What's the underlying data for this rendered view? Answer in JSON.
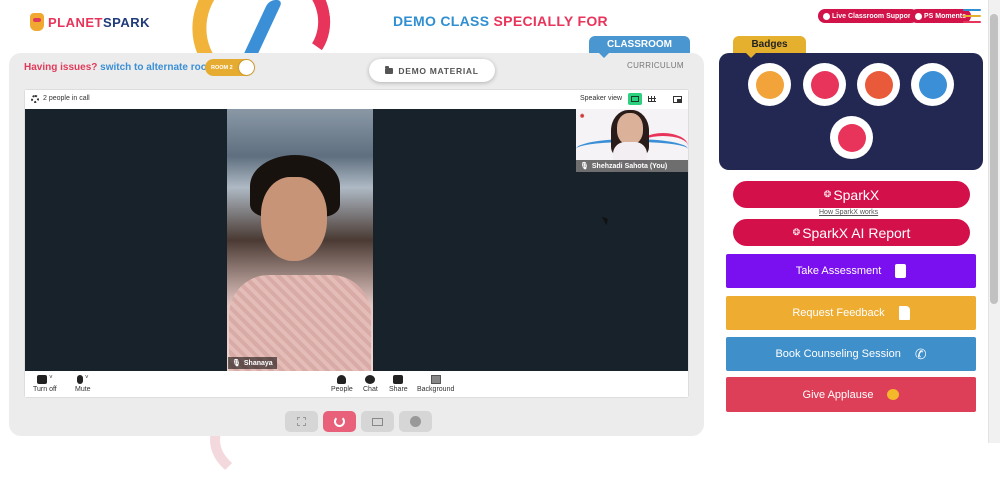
{
  "header": {
    "logo_part1": "PLANET",
    "logo_part2": "SPARK",
    "title_part1": "DEMO CLASS",
    "title_part2": "SPECIALLY FOR",
    "live_support_label": "Live Classroom Support",
    "ps_moments_label": "PS Moments",
    "menu_colors": [
      "#2f8fd1",
      "#e5b02d",
      "#e8345a"
    ]
  },
  "classroom": {
    "tab_label": "CLASSROOM",
    "curriculum_label": "CURRICULUM",
    "issues_question": "Having issues?",
    "issues_link": "switch to alternate room",
    "room_toggle_label": "ROOM 2",
    "demo_material_label": "DEMO MATERIAL",
    "call": {
      "people_in_call": "2 people in call",
      "speaker_view_label": "Speaker view",
      "main_participant": "Shanaya",
      "self_participant": "Shehzadi Sahota (You)",
      "controls": [
        {
          "label": "Turn off",
          "icon": "camera-icon"
        },
        {
          "label": "Mute",
          "icon": "microphone-icon"
        },
        {
          "label": "People",
          "icon": "people-icon"
        },
        {
          "label": "Chat",
          "icon": "chat-icon"
        },
        {
          "label": "Share",
          "icon": "share-screen-icon"
        },
        {
          "label": "Background",
          "icon": "background-icon"
        }
      ]
    },
    "bottom_controls": [
      "fullscreen-icon",
      "power-icon",
      "screen-icon",
      "palette-icon"
    ]
  },
  "badges": {
    "tab_label": "Badges",
    "items": [
      {
        "icon": "trophy-badge-icon",
        "color": "#f2a33a"
      },
      {
        "icon": "hands-badge-icon",
        "color": "#e8345a"
      },
      {
        "icon": "rocket-badge-icon",
        "color": "#e85a3a"
      },
      {
        "icon": "brain-badge-icon",
        "color": "#3a8fd6"
      },
      {
        "icon": "robot-badge-icon",
        "color": "#e8345a"
      }
    ]
  },
  "sidebar": {
    "sparkx_label": "SparkX",
    "how_sparkx_link": "How SparkX works",
    "sparkx_report_label": "SparkX AI Report",
    "actions": [
      {
        "label": "Take Assessment",
        "icon": "clipboard-icon",
        "color": "#7a0ff0"
      },
      {
        "label": "Request Feedback",
        "icon": "document-icon",
        "color": "#eeac30"
      },
      {
        "label": "Book Counseling Session",
        "icon": "phone-icon",
        "color": "#3f8fcb"
      },
      {
        "label": "Give Applause",
        "icon": "clap-icon",
        "color": "#dd3f58"
      }
    ]
  }
}
